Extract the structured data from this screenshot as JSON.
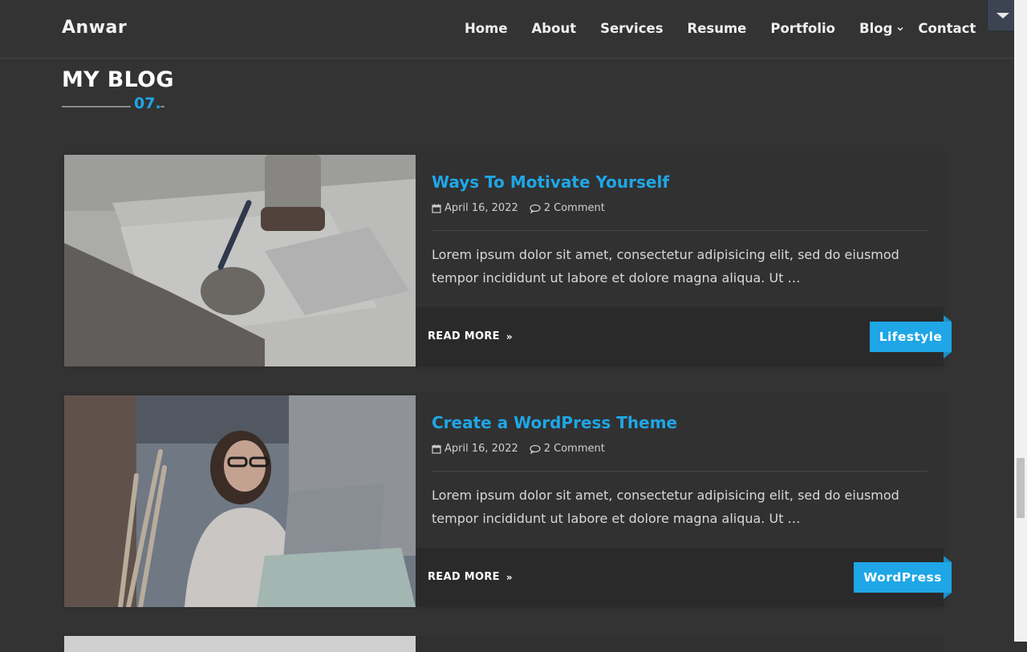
{
  "header": {
    "brand": "Anwar",
    "nav": [
      {
        "label": "Home"
      },
      {
        "label": "About"
      },
      {
        "label": "Services"
      },
      {
        "label": "Resume"
      },
      {
        "label": "Portfolio"
      },
      {
        "label": "Blog"
      },
      {
        "label": "Contact"
      }
    ]
  },
  "section": {
    "title": "MY BLOG",
    "number": "07."
  },
  "posts": [
    {
      "title": "Ways To Motivate Yourself",
      "date": "April 16, 2022",
      "comments": "2 Comment",
      "excerpt": "Lorem ipsum dolor sit amet, consectetur adipisicing elit, sed do eiusmod tempor incididunt ut labore et dolore magna aliqua. Ut …",
      "read_more": "READ MORE",
      "category": "Lifestyle"
    },
    {
      "title": "Create a WordPress Theme",
      "date": "April 16, 2022",
      "comments": "2 Comment",
      "excerpt": "Lorem ipsum dolor sit amet, consectetur adipisicing elit, sed do eiusmod tempor incididunt ut labore et dolore magna aliqua. Ut …",
      "read_more": "READ MORE",
      "category": "WordPress"
    }
  ],
  "colors": {
    "accent": "#1fa6e6",
    "background": "#333333",
    "card": "#303030",
    "footer": "#2a2a2a"
  },
  "icons": [
    "calendar-icon",
    "comment-icon",
    "chevron-down-icon",
    "double-chevron-right-icon",
    "caret-down-icon"
  ]
}
